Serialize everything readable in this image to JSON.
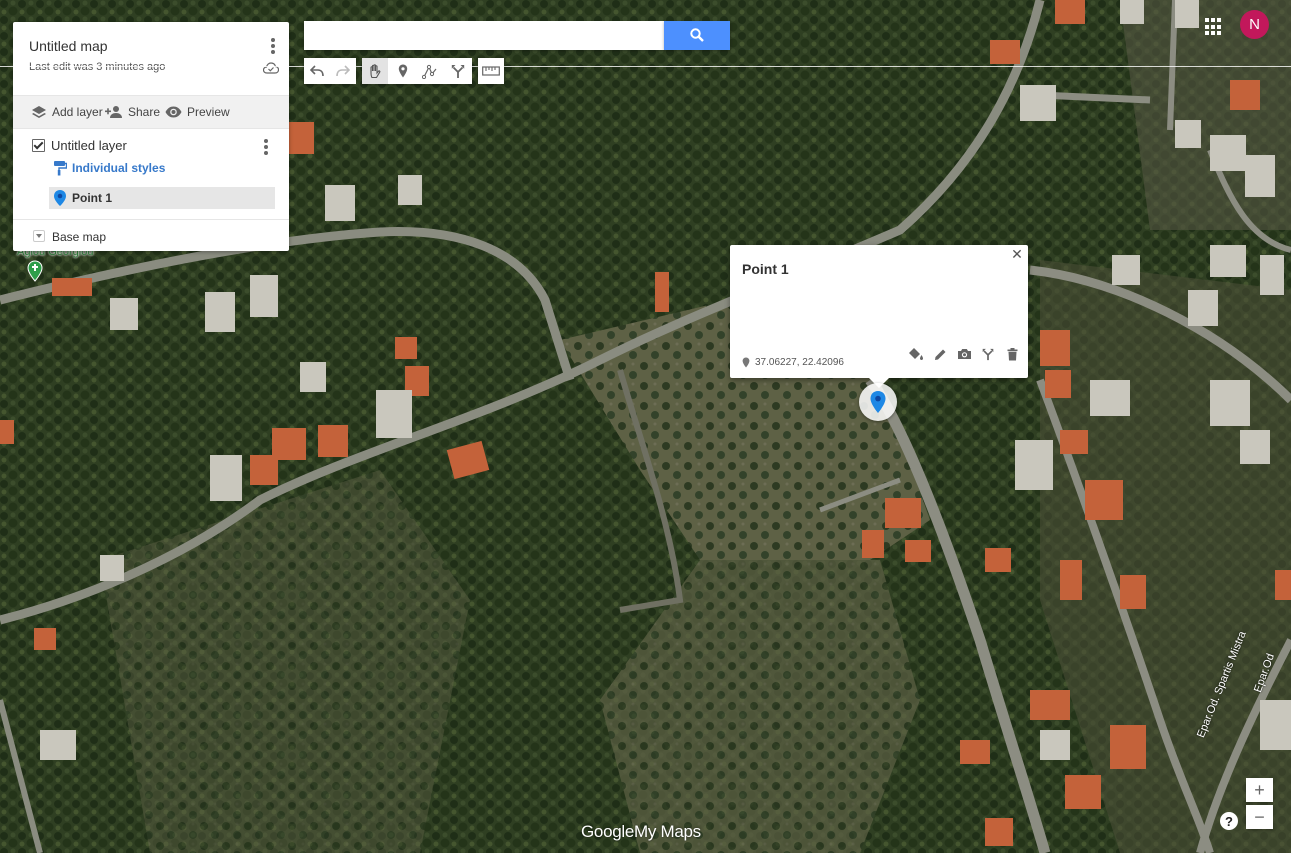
{
  "panel": {
    "title": "Untitled map",
    "last_edit": "Last edit was 3 minutes ago",
    "actions": {
      "add_layer": "Add layer",
      "share": "Share",
      "preview": "Preview"
    },
    "layer": {
      "name": "Untitled layer",
      "styles_label": "Individual styles",
      "checked": true,
      "items": [
        {
          "label": "Point 1",
          "icon": "blue-pin-icon"
        }
      ]
    },
    "base_map": "Base map"
  },
  "search": {
    "value": "",
    "placeholder": ""
  },
  "toolbar": {
    "icons": [
      "undo-icon",
      "redo-icon",
      "hand-icon",
      "marker-icon",
      "draw-line-icon",
      "directions-icon",
      "ruler-icon"
    ],
    "selected": "hand-icon"
  },
  "user": {
    "initial": "N",
    "avatar_color": "#c2185b"
  },
  "info_window": {
    "title": "Point 1",
    "coordinates": "37.06227, 22.42096",
    "tools": [
      "paint-bucket-icon",
      "pencil-icon",
      "camera-icon",
      "directions-icon",
      "trash-icon"
    ]
  },
  "map": {
    "place_label": "Agiou Georgiou",
    "road_label_1": "Epar.Od. Spartis Mistra",
    "road_label_2": "Epar.Od"
  },
  "branding": {
    "google": "Google",
    "my_maps": "My Maps"
  },
  "zoom": {
    "in": "+",
    "out": "−"
  },
  "help": "?",
  "colors": {
    "accent": "#4d90fe",
    "link": "#3779ca",
    "pin": "#1e88e5"
  }
}
